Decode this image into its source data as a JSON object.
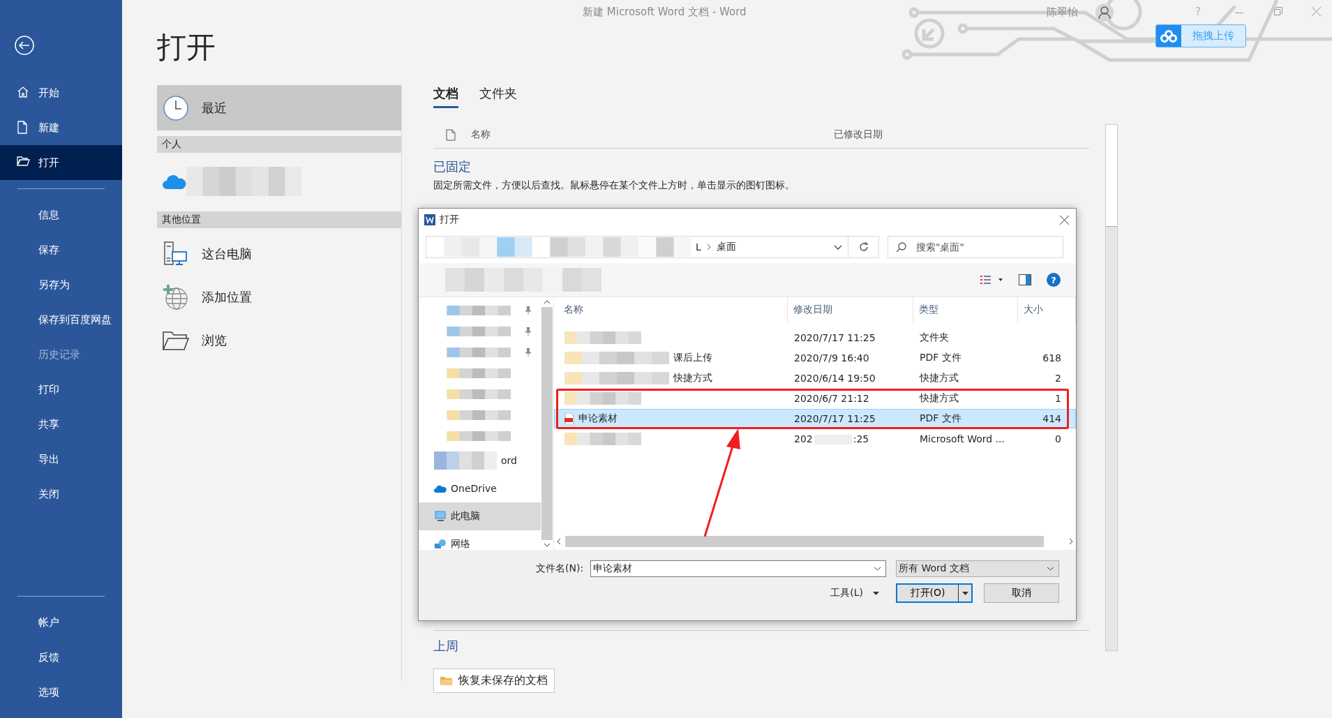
{
  "window": {
    "title": "新建 Microsoft Word 文档  -  Word",
    "user": "陈翠怡",
    "help": "?"
  },
  "upload_widget": {
    "label": "拖拽上传"
  },
  "sidebar": {
    "items": [
      {
        "label": "开始",
        "kind": "home",
        "selected": false,
        "disabled": false
      },
      {
        "label": "新建",
        "kind": "new",
        "selected": false,
        "disabled": false
      },
      {
        "label": "打开",
        "kind": "open",
        "selected": true,
        "disabled": false
      },
      {
        "kind": "divider"
      },
      {
        "label": "信息",
        "kind": "text",
        "selected": false,
        "disabled": false
      },
      {
        "label": "保存",
        "kind": "text",
        "selected": false,
        "disabled": false
      },
      {
        "label": "另存为",
        "kind": "text",
        "selected": false,
        "disabled": false
      },
      {
        "label": "保存到百度网盘",
        "kind": "text",
        "selected": false,
        "disabled": false
      },
      {
        "label": "历史记录",
        "kind": "text",
        "selected": false,
        "disabled": true
      },
      {
        "label": "打印",
        "kind": "text",
        "selected": false,
        "disabled": false
      },
      {
        "label": "共享",
        "kind": "text",
        "selected": false,
        "disabled": false
      },
      {
        "label": "导出",
        "kind": "text",
        "selected": false,
        "disabled": false
      },
      {
        "label": "关闭",
        "kind": "text",
        "selected": false,
        "disabled": false
      }
    ],
    "footer_items": [
      {
        "label": "帐户",
        "selected": false
      },
      {
        "label": "反馈",
        "selected": false
      },
      {
        "label": "选项",
        "selected": false
      }
    ]
  },
  "page_title": "打开",
  "locations": [
    {
      "kind": "recent",
      "label": "最近",
      "selected": true
    },
    {
      "kind": "header",
      "label": "个人"
    },
    {
      "kind": "onedrive",
      "selected": false
    },
    {
      "kind": "header",
      "label": "其他位置"
    },
    {
      "kind": "pc",
      "label": "这台电脑",
      "selected": false
    },
    {
      "kind": "add",
      "label": "添加位置",
      "selected": false
    },
    {
      "kind": "browse",
      "label": "浏览",
      "selected": false
    }
  ],
  "documents": {
    "tabs": [
      {
        "label": "文档",
        "selected": true
      },
      {
        "label": "文件夹",
        "selected": false
      }
    ],
    "columns": [
      "名称",
      "已修改日期"
    ],
    "pinned_title": "已固定",
    "pinned_hint": "固定所需文件，方便以后查找。鼠标悬停在某个文件上方时，单击显示的图钉图标。",
    "group_title": "上周",
    "recover_button": "恢复未保存的文档"
  },
  "dialog": {
    "title": "打开",
    "breadcrumb": [
      "L",
      "桌面"
    ],
    "search": {
      "placeholder": "搜索\"桌面\""
    },
    "help": "?",
    "nav": [
      {
        "kind": "blurred",
        "pinned": true,
        "selected": false
      },
      {
        "kind": "blurred",
        "pinned": true,
        "selected": false
      },
      {
        "kind": "blurred",
        "pinned": true,
        "selected": false
      },
      {
        "kind": "blurred",
        "pinned": false,
        "selected": false
      },
      {
        "kind": "blurred",
        "pinned": false,
        "selected": false
      },
      {
        "kind": "blurred",
        "pinned": false,
        "selected": false
      },
      {
        "kind": "blurred",
        "pinned": false,
        "selected": false
      },
      {
        "kind": "folder",
        "label": "ord",
        "selected": false
      },
      {
        "kind": "onedrive",
        "label": "OneDrive",
        "selected": false
      },
      {
        "kind": "pc",
        "label": "此电脑",
        "selected": true
      },
      {
        "kind": "network",
        "label": "网络",
        "selected": false
      }
    ],
    "columns": [
      "名称",
      "修改日期",
      "类型",
      "大小"
    ],
    "rows": [
      {
        "kind": "blurred",
        "date": "2020/7/17 11:25",
        "type": "文件夹",
        "selected": false
      },
      {
        "kind": "blurred",
        "name": "课后上传",
        "date": "2020/7/9 16:40",
        "type": "PDF 文件",
        "size": "618",
        "selected": false
      },
      {
        "kind": "blurred",
        "name": "快捷方式",
        "date": "2020/6/14 19:50",
        "type": "快捷方式",
        "size": "2",
        "selected": false
      },
      {
        "kind": "blurred",
        "date": "2020/6/7 21:12",
        "type": "快捷方式",
        "size": "1",
        "selected": false
      },
      {
        "kind": "pdf",
        "name": "申论素材",
        "date": "2020/7/17 11:25",
        "type": "PDF 文件",
        "size": "414",
        "selected": true
      },
      {
        "kind": "blurred",
        "date_parts": [
          "202",
          ":25"
        ],
        "type": "Microsoft Word ...",
        "size": "0",
        "selected": false
      }
    ],
    "file_name_label": "文件名(N):",
    "file_name": "申论素材",
    "filter": "所有 Word 文档",
    "tools": "工具(L)",
    "open_button": "打开(O)",
    "cancel_button": "取消"
  }
}
